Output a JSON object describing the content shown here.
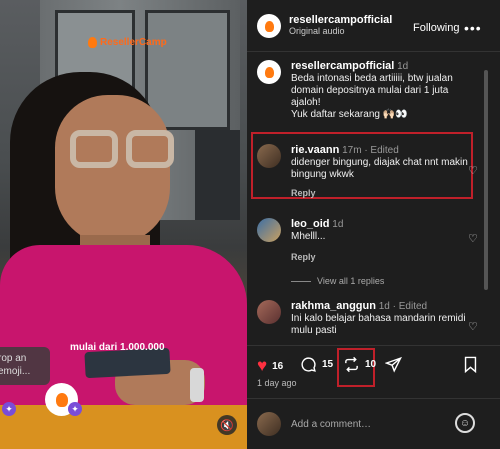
{
  "video": {
    "brand_logo_text": "ResellerCamp",
    "price_overlay": "mulai dari 1.000.000",
    "prop_text": "rop an emoji...",
    "badge_icon": "sparkle-icon",
    "mute_icon": "speaker-muted-icon"
  },
  "header": {
    "username": "resellercampofficial",
    "subtitle": "Original audio",
    "follow_label": "Following",
    "more_label": "•••"
  },
  "comments": [
    {
      "username": "resellercampofficial",
      "time": "1d",
      "text": "Beda intonasi beda artiiiii, btw jualan domain depositnya mulai dari 1 juta ajaloh!\nYuk daftar sekarang 🙌🏻👀"
    },
    {
      "username": "rie.vaann",
      "time": "17m · Edited",
      "text": "didenger bingung, diajak chat nnt makin bingung wkwk",
      "reply": "Reply"
    },
    {
      "username": "leo_oid",
      "time": "1d",
      "text": "Mhelll...",
      "reply": "Reply"
    },
    {
      "username": "rakhma_anggun",
      "time": "1d · Edited",
      "text": "Ini kalo belajar bahasa mandarin remidi mulu pasti"
    }
  ],
  "view_all": "View all 1 replies",
  "actions": {
    "likes": "16",
    "comments": "15",
    "reposts": "10",
    "like_icon": "heart-icon",
    "comment_icon": "speech-bubble-icon",
    "repost_icon": "repost-icon",
    "share_icon": "send-icon",
    "save_icon": "bookmark-icon"
  },
  "posted_ago": "1 day ago",
  "add_comment": {
    "placeholder": "Add a comment…"
  },
  "colors": {
    "accent_red": "#c0202a",
    "like_red": "#ff3040",
    "brand_orange": "#ff7a10"
  }
}
